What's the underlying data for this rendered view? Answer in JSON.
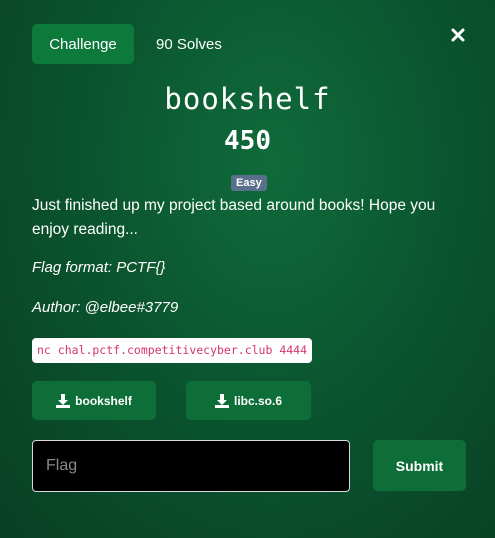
{
  "tabs": {
    "challenge_label": "Challenge",
    "solves_label": "90 Solves"
  },
  "close": {
    "icon": "close-icon"
  },
  "challenge": {
    "name": "bookshelf",
    "points": "450",
    "difficulty": "Easy",
    "description": "Just finished up my project based around books! Hope you enjoy reading...",
    "flag_format": "Flag format: PCTF{}",
    "author": "Author: @elbee#3779",
    "connection": "nc chal.pctf.competitivecyber.club 4444"
  },
  "files": [
    {
      "label": "bookshelf",
      "icon": "download-icon"
    },
    {
      "label": "libc.so.6",
      "icon": "download-icon"
    }
  ],
  "submission": {
    "placeholder": "Flag",
    "value": "",
    "submit_label": "Submit"
  },
  "colors": {
    "background": "#0b5530",
    "accent_button": "#0d7a3c",
    "badge": "#5a6f8c",
    "code_text": "#d6336c"
  }
}
